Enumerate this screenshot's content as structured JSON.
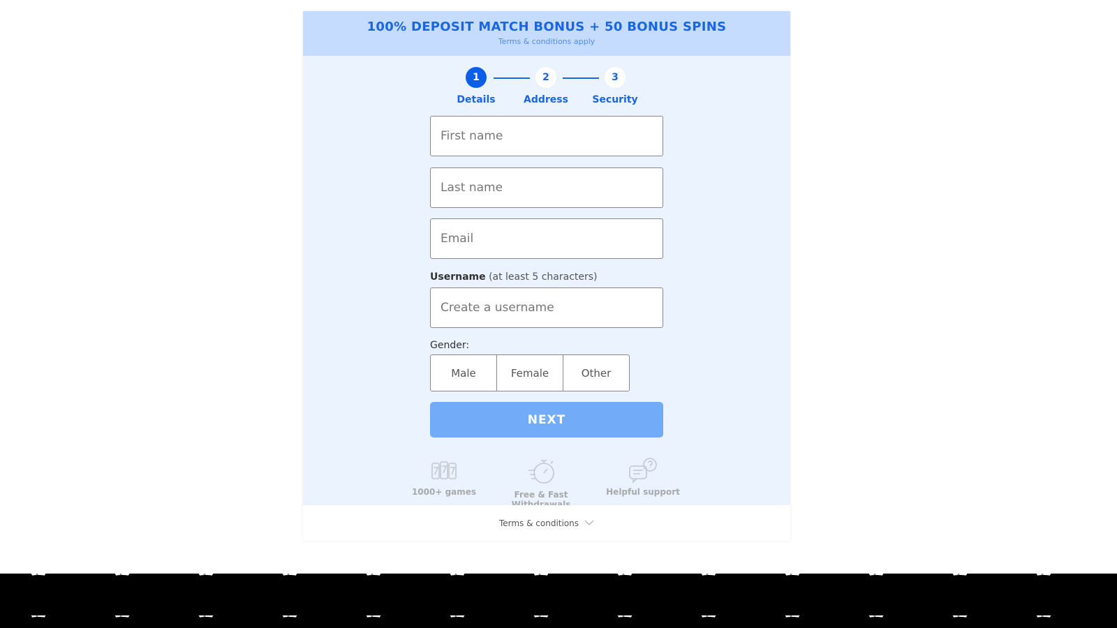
{
  "promo": {
    "title": "100% DEPOSIT MATCH BONUS + 50 BONUS SPINS",
    "subtitle": "Terms & conditions apply"
  },
  "steps": [
    {
      "number": "1",
      "label": "Details",
      "active": true
    },
    {
      "number": "2",
      "label": "Address",
      "active": false
    },
    {
      "number": "3",
      "label": "Security",
      "active": false
    }
  ],
  "form": {
    "first_name": {
      "placeholder": "First name",
      "value": ""
    },
    "last_name": {
      "placeholder": "Last name",
      "value": ""
    },
    "email": {
      "placeholder": "Email",
      "value": ""
    },
    "username": {
      "label": "Username",
      "hint": "(at least 5 characters)",
      "placeholder": "Create a username",
      "value": ""
    },
    "gender": {
      "label": "Gender:",
      "options": [
        "Male",
        "Female",
        "Other"
      ]
    },
    "next_label": "NEXT"
  },
  "features": [
    {
      "icon": "slot-777-icon",
      "label": "1000+ games"
    },
    {
      "icon": "stopwatch-icon",
      "label": "Free & Fast Withdrawals"
    },
    {
      "icon": "chat-support-icon",
      "label": "Helpful support"
    }
  ],
  "footer": {
    "terms_label": "Terms & conditions",
    "icon": "chevron-down-icon"
  },
  "colors": {
    "accent": "#0a5ee8",
    "promo_bg": "#c5dcff",
    "card_bg": "#eaf3ff",
    "next_button": "#72acf9"
  }
}
